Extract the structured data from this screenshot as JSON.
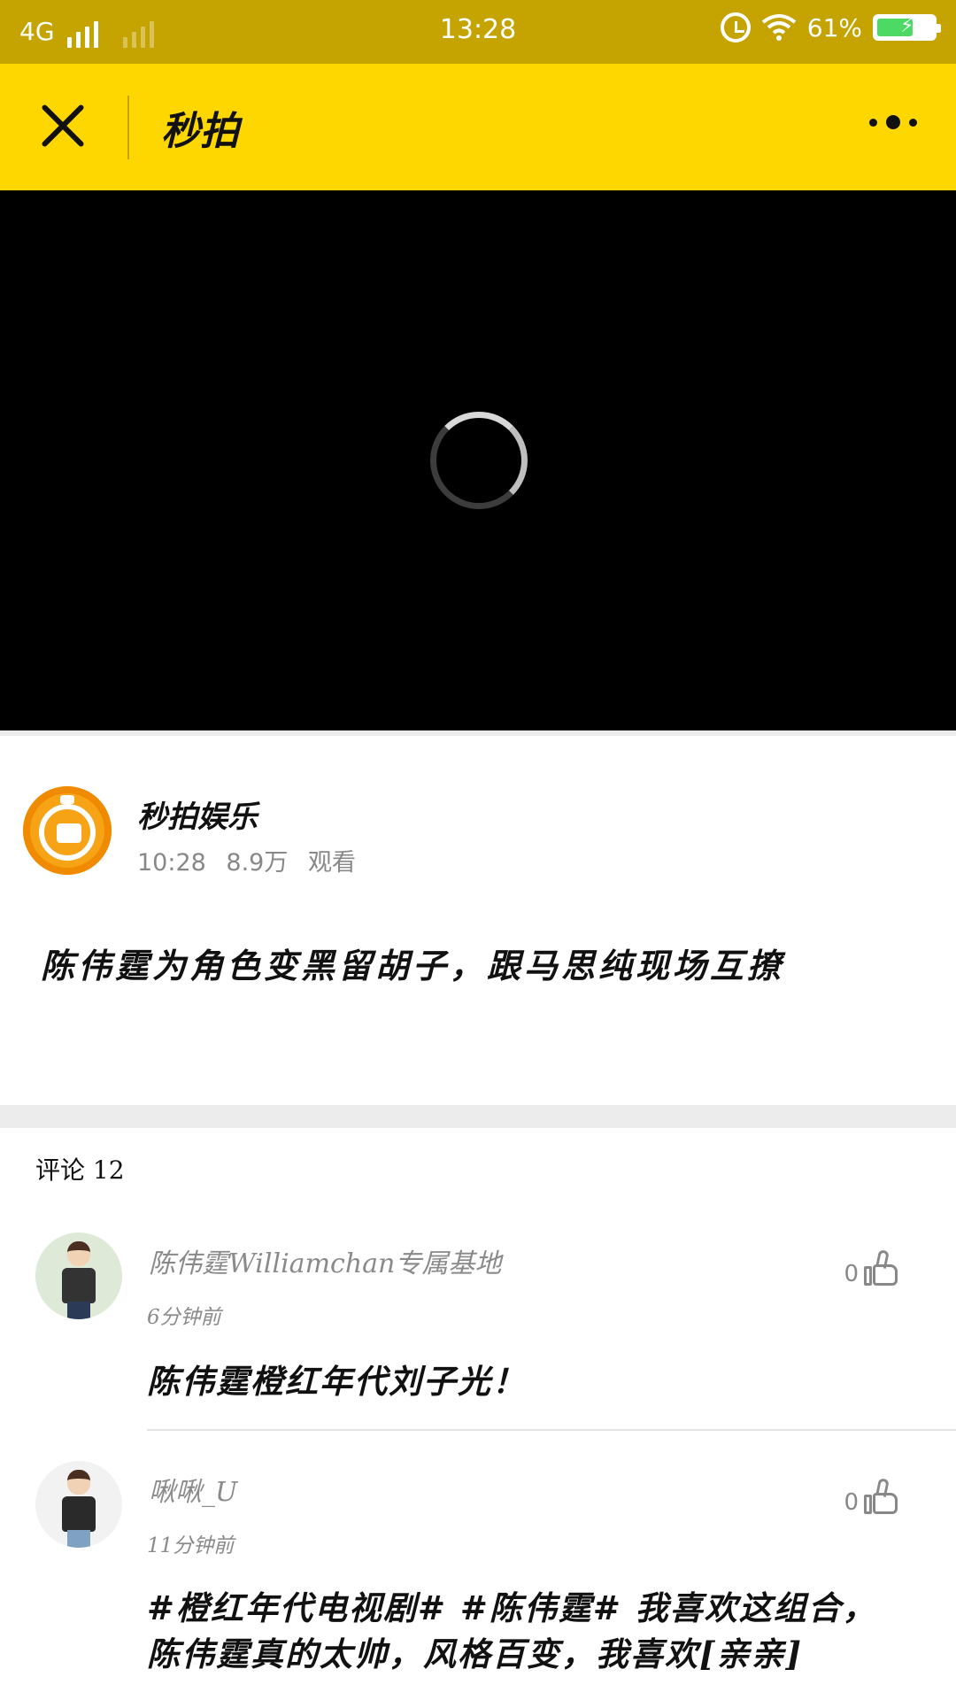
{
  "status_bar": {
    "network": "4G",
    "time": "13:28",
    "battery": "61%"
  },
  "title_bar": {
    "title": "秒拍"
  },
  "author": {
    "name": "秒拍娱乐",
    "time": "10:28",
    "views": "8.9万",
    "views_label": "观看"
  },
  "video": {
    "title": "陈伟霆为角色变黑留胡子，跟马思纯现场互撩"
  },
  "comments": {
    "header": "评论 12",
    "items": [
      {
        "name": "陈伟霆Williamchan专属基地",
        "time": "6分钟前",
        "likes": "0",
        "text": "陈伟霆橙红年代刘子光！"
      },
      {
        "name": "啾啾_U",
        "time": "11分钟前",
        "likes": "0",
        "text_line1": "#橙红年代电视剧# #陈伟霆# 我喜欢这组合，",
        "text_line2": "陈伟霆真的太帅，风格百变，我喜欢[亲亲]"
      }
    ]
  }
}
